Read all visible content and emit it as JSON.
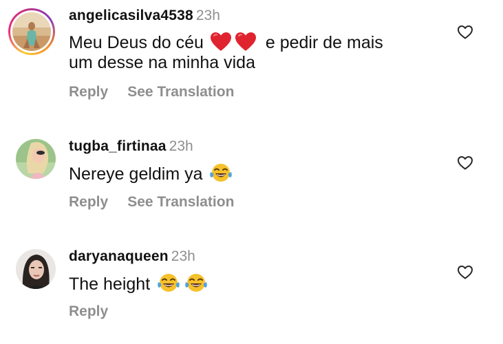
{
  "comments": [
    {
      "username": "angelicasilva4538",
      "time": "23h",
      "text_before": "Meu Deus do céu",
      "emojis_inline": [
        "red-heart",
        "red-heart"
      ],
      "text_after": "e pedir de mais",
      "text_line2": "um desse na minha vida",
      "reply_label": "Reply",
      "translation_label": "See Translation",
      "has_story": true
    },
    {
      "username": "tugba_firtinaa",
      "time": "23h",
      "text_before": "Nereye geldim ya",
      "emojis_inline": [
        "tears-of-joy"
      ],
      "reply_label": "Reply",
      "translation_label": "See Translation"
    },
    {
      "username": "daryanaqueen",
      "time": "23h",
      "text_before": "The height",
      "emojis_inline": [
        "tears-of-joy",
        "tears-of-joy"
      ],
      "reply_label": "Reply"
    }
  ],
  "colors": {
    "text": "#111111",
    "secondary": "#8e8e8e",
    "heart_emoji": "#e0242f",
    "joy_face": "#f6c12b",
    "tear": "#4fa3e0"
  },
  "icons": {
    "like": "heart-outline-icon"
  }
}
